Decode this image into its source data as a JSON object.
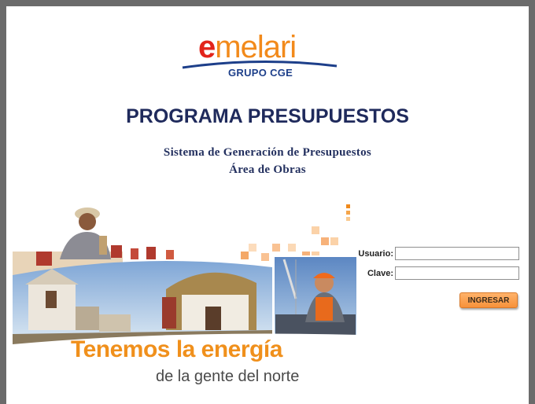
{
  "logo": {
    "word_e": "e",
    "word_rest": "melari",
    "sub": "GRUPO CGE"
  },
  "header": {
    "title": "PROGRAMA PRESUPUESTOS",
    "subtitle_line1": "Sistema de Generación de Presupuestos",
    "subtitle_line2": "Área de Obras"
  },
  "banner": {
    "tagline1": "Tenemos la energía",
    "tagline2": "de la gente del norte"
  },
  "login": {
    "user_label": "Usuario:",
    "user_value": "",
    "pass_label": "Clave:",
    "pass_value": "",
    "submit_label": "INGRESAR"
  },
  "colors": {
    "brand_red": "#e2241b",
    "brand_orange": "#f28a1b",
    "brand_blue": "#1d3f8a",
    "title_navy": "#1f2a5c"
  }
}
